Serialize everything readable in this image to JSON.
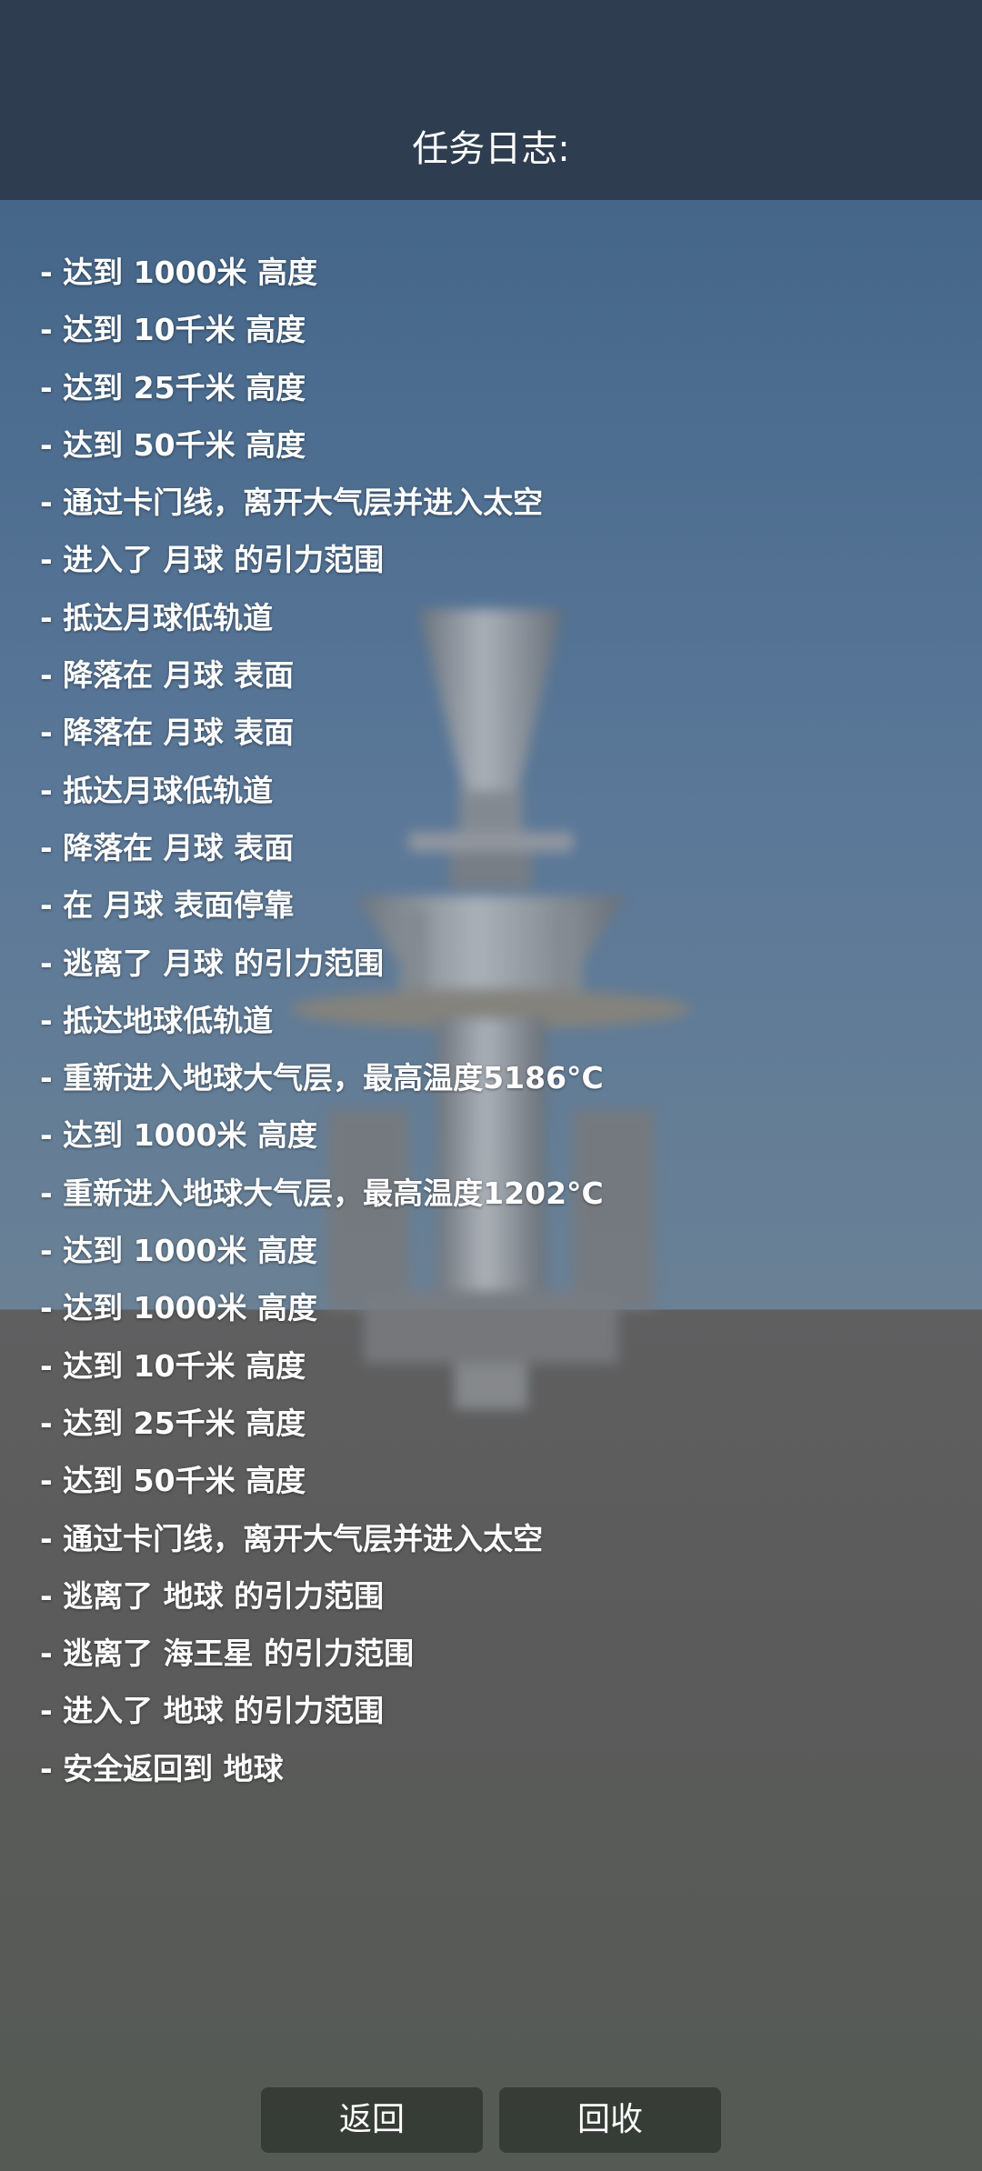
{
  "header": {
    "title": "任务日志:"
  },
  "log": {
    "entries": [
      "- 达到 1000米 高度",
      "- 达到 10千米 高度",
      "- 达到 25千米 高度",
      "- 达到 50千米 高度",
      "- 通过卡门线，离开大气层并进入太空",
      "- 进入了 月球 的引力范围",
      "- 抵达月球低轨道",
      "- 降落在 月球 表面",
      "- 降落在 月球 表面",
      "- 抵达月球低轨道",
      "- 降落在 月球 表面",
      "- 在 月球 表面停靠",
      "- 逃离了 月球 的引力范围",
      "- 抵达地球低轨道",
      "- 重新进入地球大气层，最高温度5186°C",
      "- 达到 1000米 高度",
      "- 重新进入地球大气层，最高温度1202°C",
      "- 达到 1000米 高度",
      "- 达到 1000米 高度",
      "- 达到 10千米 高度",
      "- 达到 25千米 高度",
      "- 达到 50千米 高度",
      "- 通过卡门线，离开大气层并进入太空",
      "- 逃离了 地球 的引力范围",
      "- 逃离了 海王星 的引力范围",
      "- 进入了 地球 的引力范围",
      "- 安全返回到 地球"
    ]
  },
  "buttons": {
    "back": "返回",
    "recover": "回收"
  },
  "colors": {
    "header_bg": "#2e3d4f",
    "sky": "#4b6c8f",
    "ground": "#5b5b5b",
    "button_bg": "#343a34",
    "text": "#ffffff"
  }
}
